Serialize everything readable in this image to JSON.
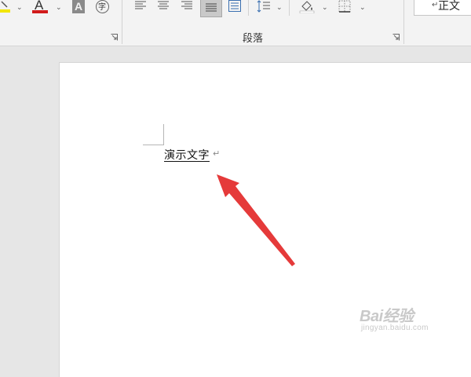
{
  "ribbon": {
    "font_color_glyph": "A",
    "text_effects_glyph": "A",
    "phonetic_glyph": "字",
    "paragraph_group_label": "段落",
    "style_preview": "正文",
    "highlight_color": "#f2e600",
    "font_color": "#d11b1b"
  },
  "document": {
    "text": "演示文字",
    "paragraph_mark": "↵"
  },
  "annotation": {
    "arrow_color": "#e53a3a"
  },
  "watermark": {
    "brand": "Bai经验",
    "url": "jingyan.baidu.com"
  }
}
